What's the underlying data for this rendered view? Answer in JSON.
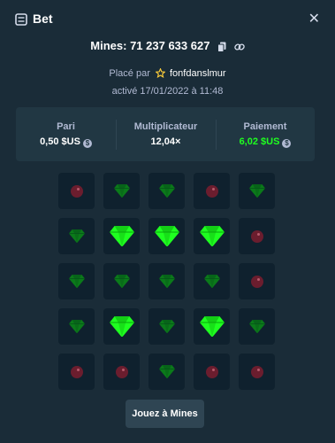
{
  "header": {
    "title": "Bet",
    "close_glyph": "✕",
    "icon": "bet-ticket-icon"
  },
  "mines": {
    "label": "Mines: 71 237 633 627",
    "copy_icon": "copy-icon",
    "link_icon": "link-icon"
  },
  "placed": {
    "prefix": "Placé par",
    "user": "fonfdanslmur",
    "icon": "star-icon"
  },
  "activated": "activé 17/01/2022 à 11:48",
  "stats": {
    "bet": {
      "label": "Pari",
      "value": "0,50 $US"
    },
    "multiplier": {
      "label": "Multiplicateur",
      "value": "12,04×"
    },
    "payout": {
      "label": "Paiement",
      "value": "6,02 $US"
    }
  },
  "grid": {
    "rows": 5,
    "cols": 5,
    "tiles": [
      "mine",
      "gem",
      "gem",
      "mine",
      "gem",
      "gem",
      "gem-revealed",
      "gem-revealed",
      "gem-revealed",
      "mine",
      "gem",
      "gem",
      "gem",
      "gem",
      "mine",
      "gem",
      "gem-revealed",
      "gem",
      "gem-revealed",
      "gem",
      "mine",
      "mine",
      "gem",
      "mine",
      "mine"
    ]
  },
  "play_button": "Jouez à Mines",
  "colors": {
    "background": "#1a2c38",
    "panel": "#213743",
    "tile": "#0f212e",
    "gem_revealed": "#1fff20",
    "gem_dim": "#0b7a1a",
    "mine": "#6b1d2e",
    "payout": "#1fff20"
  }
}
